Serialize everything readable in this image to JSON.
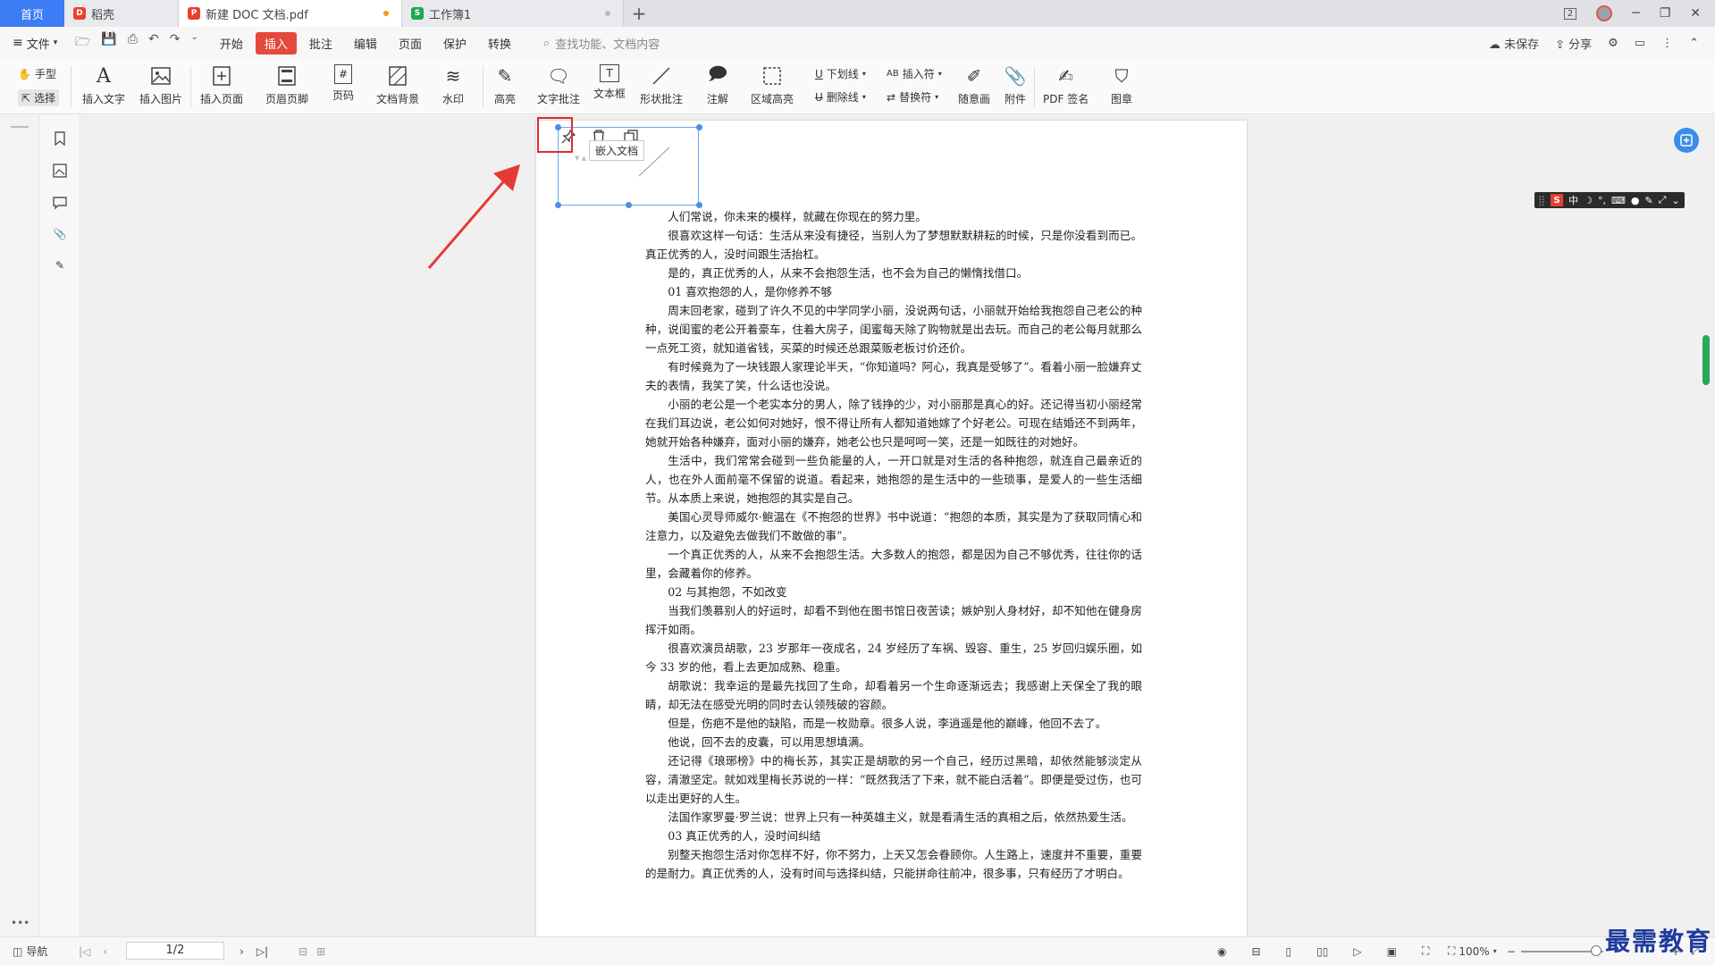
{
  "tabs": [
    {
      "label": "首页"
    },
    {
      "label": "稻壳"
    },
    {
      "label": "新建 DOC 文档.pdf"
    },
    {
      "label": "工作簿1"
    }
  ],
  "titlebar": {
    "new_tab": "+",
    "badge": "2"
  },
  "menubar": {
    "file": "文件",
    "tabs": [
      "开始",
      "插入",
      "批注",
      "编辑",
      "页面",
      "保护",
      "转换"
    ],
    "active_tab": "插入",
    "search_placeholder": "查找功能、文档内容",
    "unsaved": "未保存",
    "share": "分享"
  },
  "ribbon": {
    "hand": "手型",
    "select": "选择",
    "insert_text": "插入文字",
    "insert_image": "插入图片",
    "insert_page": "插入页面",
    "header_footer": "页眉页脚",
    "page_num": "页码",
    "doc_bg": "文档背景",
    "watermark": "水印",
    "highlight": "高亮",
    "text_comment": "文字批注",
    "textbox": "文本框",
    "shape_comment": "形状批注",
    "note": "注解",
    "area_highlight": "区域高亮",
    "underline": "下划线",
    "strikethrough": "删除线",
    "insert_char": "插入符",
    "replace_char": "替换符",
    "freehand": "随意画",
    "attachment": "附件",
    "pdf_sign": "PDF 签名",
    "stamp": "图章"
  },
  "embed": {
    "tooltip": "嵌入文档"
  },
  "document": {
    "paragraphs": [
      "人们常说，你未来的模样，就藏在你现在的努力里。",
      "很喜欢这样一句话：生活从来没有捷径，当别人为了梦想默默耕耘的时候，只是你没看到而已。真正优秀的人，没时间跟生活抬杠。",
      "是的，真正优秀的人，从来不会抱怨生活，也不会为自己的懒惰找借口。",
      "01 喜欢抱怨的人，是你修养不够",
      "周末回老家，碰到了许久不见的中学同学小丽，没说两句话，小丽就开始给我抱怨自己老公的种种，说闺蜜的老公开着豪车，住着大房子，闺蜜每天除了购物就是出去玩。而自己的老公每月就那么一点死工资，就知道省钱，买菜的时候还总跟菜贩老板讨价还价。",
      "有时候竟为了一块钱跟人家理论半天，“你知道吗？阿心，我真是受够了”。看着小丽一脸嫌弃丈夫的表情，我笑了笑，什么话也没说。",
      "小丽的老公是一个老实本分的男人，除了钱挣的少，对小丽那是真心的好。还记得当初小丽经常在我们耳边说，老公如何对她好，恨不得让所有人都知道她嫁了个好老公。可现在结婚还不到两年，她就开始各种嫌弃，面对小丽的嫌弃，她老公也只是呵呵一笑，还是一如既往的对她好。",
      "生活中，我们常常会碰到一些负能量的人，一开口就是对生活的各种抱怨，就连自己最亲近的人，也在外人面前毫不保留的说道。看起来，她抱怨的是生活中的一些琐事，是爱人的一些生活细节。从本质上来说，她抱怨的其实是自己。",
      "美国心灵导师威尔·鲍温在《不抱怨的世界》书中说道：“抱怨的本质，其实是为了获取同情心和注意力，以及避免去做我们不敢做的事”。",
      "一个真正优秀的人，从来不会抱怨生活。大多数人的抱怨，都是因为自己不够优秀，往往你的话里，会藏着你的修养。",
      "02 与其抱怨，不如改变",
      "当我们羡慕别人的好运时，却看不到他在图书馆日夜苦读；嫉妒别人身材好，却不知他在健身房挥汗如雨。",
      "很喜欢演员胡歌，23 岁那年一夜成名，24 岁经历了车祸、毁容、重生，25 岁回归娱乐圈，如今 33 岁的他，看上去更加成熟、稳重。",
      "胡歌说：我幸运的是最先找回了生命，却看着另一个生命逐渐远去；我感谢上天保全了我的眼睛，却无法在感受光明的同时去认领残破的容颜。",
      "但是，伤疤不是他的缺陷，而是一枚勋章。很多人说，李逍遥是他的巅峰，他回不去了。",
      "他说，回不去的皮囊，可以用思想填满。",
      "还记得《琅琊榜》中的梅长苏，其实正是胡歌的另一个自己，经历过黑暗，却依然能够淡定从容，清澈坚定。就如戏里梅长苏说的一样：“既然我活了下来，就不能白活着”。即便是受过伤，也可以走出更好的人生。",
      "法国作家罗曼·罗兰说：世界上只有一种英雄主义，就是看清生活的真相之后，依然热爱生活。",
      "03 真正优秀的人，没时间纠结",
      "别整天抱怨生活对你怎样不好，你不努力，上天又怎会眷顾你。人生路上，速度并不重要，重要的是耐力。真正优秀的人，没有时间与选择纠结，只能拼命往前冲，很多事，只有经历了才明白。"
    ]
  },
  "ime": {
    "items": [
      "S",
      "中",
      "☽",
      "°,",
      "⌨",
      "●",
      "✎",
      "⤢",
      "⌄"
    ]
  },
  "statusbar": {
    "nav": "导航",
    "page": "1/2",
    "zoom": "100%",
    "more": "•••"
  },
  "watermark_text": "最需教育"
}
